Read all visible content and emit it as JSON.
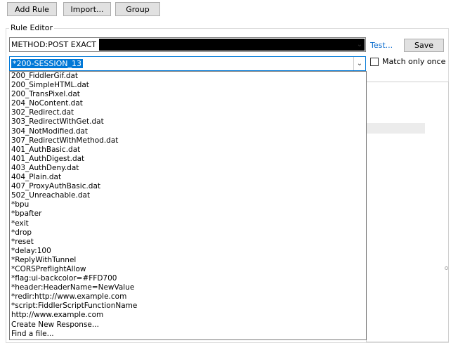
{
  "toolbar": {
    "add_rule": "Add Rule",
    "import": "Import...",
    "group": "Group"
  },
  "rule_editor": {
    "title": "Rule Editor",
    "match_text": "METHOD:POST EXACT",
    "test_link": "Test...",
    "save": "Save",
    "response_selected": "*200-SESSION_13",
    "match_only_once": "Match only once"
  },
  "dropdown_items": [
    "200_FiddlerGif.dat",
    "200_SimpleHTML.dat",
    "200_TransPixel.dat",
    "204_NoContent.dat",
    "302_Redirect.dat",
    "303_RedirectWithGet.dat",
    "304_NotModified.dat",
    "307_RedirectWithMethod.dat",
    "401_AuthBasic.dat",
    "401_AuthDigest.dat",
    "403_AuthDeny.dat",
    "404_Plain.dat",
    "407_ProxyAuthBasic.dat",
    "502_Unreachable.dat",
    "*bpu",
    "*bpafter",
    "*exit",
    "*drop",
    "*reset",
    "*delay:100",
    "*ReplyWithTunnel",
    "*CORSPreflightAllow",
    "*flag:ui-backcolor=#FFD700",
    "*header:HeaderName=NewValue",
    "*redir:http://www.example.com",
    "*script:FiddlerScriptFunctionName",
    "http://www.example.com",
    "Create New Response...",
    "Find a file..."
  ]
}
